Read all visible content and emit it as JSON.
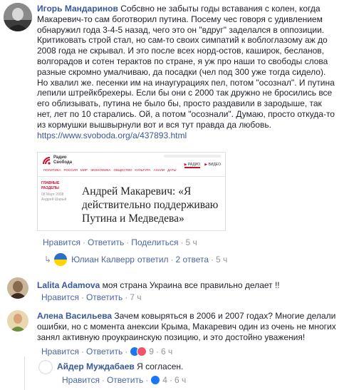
{
  "main_comment": {
    "author": "Игорь Мандаринов",
    "text_lines": [
      "Собсвно не забыты годы вставания с колен, когда",
      "Макаревич-то сам боготворил путина. Посему чес говоря с удивлением",
      "обнаружил года 3-4-5 назад, чего это он \"вдруг\" заделался в оппозиции.",
      "Критиковать строй стал, но сам-то своих симпатий к воблоглазому аж до",
      "2008 года не скрывал. И это после всех норд-остов, каширок, бесланов,",
      "волгорадов и сотен терактов по стране, я уж про наши то свободы слова",
      "разные скромно умалчиваю, да посадки (чел под 300 уже тогда сидело).",
      "Но хвалил же. песенки им на инаугурациях пел, потом \"осознал\". И путина",
      "лепили штрейкбрехеры. Если бы они с 2000 так дружно не бросились все",
      "его облизывать, путина не было бы, просто раздавили в зародыше, так",
      "нет, лет по 10 старались. Ой, а потом \"осознали\". Думаю, просто откуда-то",
      "из кормушки вышвырнули вот и вся тут правда да любовь."
    ],
    "link": "https://www.svoboda.org/a/437893.html",
    "preview": {
      "logo_line1": "Радио",
      "logo_line2": "Свобода",
      "nav_items": [
        "ПОЛИТИКА",
        "РОССИЯ",
        "МИР",
        "ЭКОНОМИКА",
        "ОБЩЕСТВО",
        "КУЛЬТУРА",
        "АНАЛИ",
        "ДАТЫ",
        "ГРОЗА"
      ],
      "radio_label": "РАДИО",
      "video_label": "ВИДЕО",
      "left_label_1": "ГЛАВНЫЕ",
      "left_label_2": "РАЗДЕЛЫ",
      "left_small_1": "08 Март 2008",
      "left_small_2": "Андрей Шарый",
      "headline": "Андрей Макаревич: «Я действительно поддерживаю Путина и Медведева»"
    },
    "actions": {
      "like": "Нравится",
      "reply": "Ответить",
      "share": "Поделиться",
      "time": "5 ч"
    },
    "replies_summary": {
      "author": "Юлиан Калверр",
      "verb": "ответил",
      "count": "2 ответа",
      "time": "5 ч"
    }
  },
  "comments": [
    {
      "author": "Lalita Adamova",
      "text": "моя страна Украина все правильно делает !!",
      "like": "Нравится",
      "reply": "Ответить",
      "time": "7 ч"
    },
    {
      "author": "Алена Васильева",
      "text_lines": [
        "Зачем ковыряться в 2006 и 2007 годах? Многие делали",
        "ошибки, но с момента анексии Крыма, Макаревич один из очень не многих",
        "занял активную проукраинскую позицию, и это достойно уважения!"
      ],
      "like": "Нравится",
      "reply": "Ответить",
      "reaction_count": "9",
      "time": "6 ч"
    }
  ],
  "nested_reply": {
    "author": "Айдер Муждабаев",
    "text": "Я согласен.",
    "like": "Нравится",
    "reply": "Ответить",
    "reaction_count": "4",
    "time": "6 ч"
  },
  "colors": {
    "link": "#385898",
    "meta": "#90949c",
    "action": "#4b67a1",
    "like_blue": "#1877f2",
    "radio_red": "#c8102e"
  }
}
